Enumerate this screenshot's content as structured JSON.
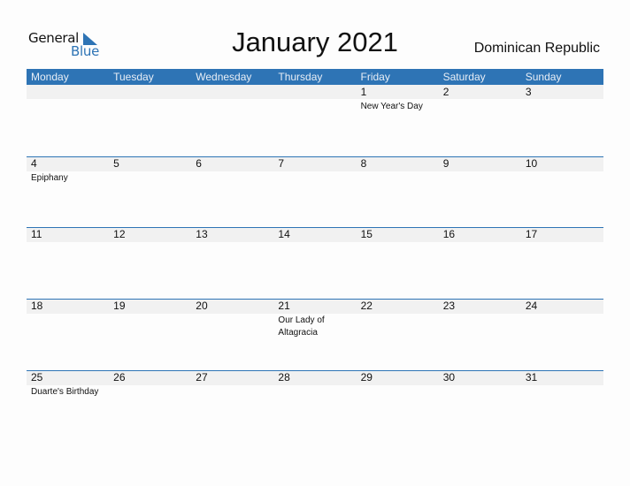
{
  "logo": {
    "line1": "General",
    "line2": "Blue",
    "icon": "triangle-flag-icon",
    "brand_color": "#2e74b5"
  },
  "title": "January 2021",
  "country": "Dominican Republic",
  "weekdays": [
    "Monday",
    "Tuesday",
    "Wednesday",
    "Thursday",
    "Friday",
    "Saturday",
    "Sunday"
  ],
  "weeks": [
    [
      {
        "day": "",
        "holiday": ""
      },
      {
        "day": "",
        "holiday": ""
      },
      {
        "day": "",
        "holiday": ""
      },
      {
        "day": "",
        "holiday": ""
      },
      {
        "day": "1",
        "holiday": "New Year's Day"
      },
      {
        "day": "2",
        "holiday": ""
      },
      {
        "day": "3",
        "holiday": ""
      }
    ],
    [
      {
        "day": "4",
        "holiday": "Epiphany"
      },
      {
        "day": "5",
        "holiday": ""
      },
      {
        "day": "6",
        "holiday": ""
      },
      {
        "day": "7",
        "holiday": ""
      },
      {
        "day": "8",
        "holiday": ""
      },
      {
        "day": "9",
        "holiday": ""
      },
      {
        "day": "10",
        "holiday": ""
      }
    ],
    [
      {
        "day": "11",
        "holiday": ""
      },
      {
        "day": "12",
        "holiday": ""
      },
      {
        "day": "13",
        "holiday": ""
      },
      {
        "day": "14",
        "holiday": ""
      },
      {
        "day": "15",
        "holiday": ""
      },
      {
        "day": "16",
        "holiday": ""
      },
      {
        "day": "17",
        "holiday": ""
      }
    ],
    [
      {
        "day": "18",
        "holiday": ""
      },
      {
        "day": "19",
        "holiday": ""
      },
      {
        "day": "20",
        "holiday": ""
      },
      {
        "day": "21",
        "holiday": "Our Lady of Altagracia"
      },
      {
        "day": "22",
        "holiday": ""
      },
      {
        "day": "23",
        "holiday": ""
      },
      {
        "day": "24",
        "holiday": ""
      }
    ],
    [
      {
        "day": "25",
        "holiday": "Duarte's Birthday"
      },
      {
        "day": "26",
        "holiday": ""
      },
      {
        "day": "27",
        "holiday": ""
      },
      {
        "day": "28",
        "holiday": ""
      },
      {
        "day": "29",
        "holiday": ""
      },
      {
        "day": "30",
        "holiday": ""
      },
      {
        "day": "31",
        "holiday": ""
      }
    ]
  ]
}
